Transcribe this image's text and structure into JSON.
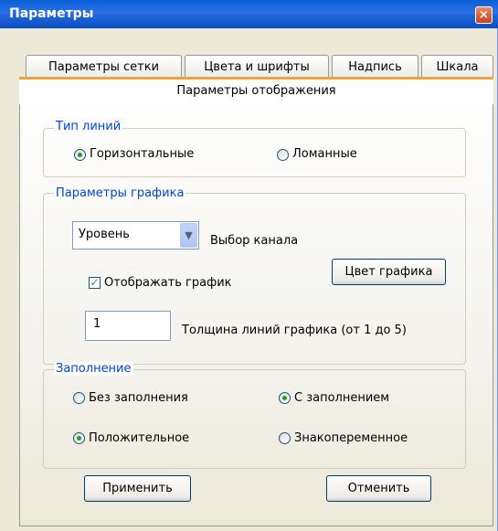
{
  "window": {
    "title": "Параметры",
    "close_icon": "×"
  },
  "tabs": [
    "Параметры сетки",
    "Цвета и шрифты",
    "Надпись",
    "Шкала"
  ],
  "active_tab": "Параметры отображения",
  "line_type": {
    "legend": "Тип линий",
    "options": [
      {
        "label": "Горизонтальные",
        "selected": true
      },
      {
        "label": "Ломанные",
        "selected": false
      }
    ]
  },
  "graph_params": {
    "legend": "Параметры графика",
    "channel_select": {
      "value": "Уровень",
      "label": "Выбор канала"
    },
    "show_graph": {
      "label": "Отображать график",
      "checked": true
    },
    "color_button": "Цвет графика",
    "thickness": {
      "value": "1",
      "label": "Толщина линий графика (от 1 до 5)"
    }
  },
  "fill": {
    "legend": "Заполнение",
    "options": [
      {
        "label": "Без заполнения",
        "selected": false
      },
      {
        "label": "С заполнением",
        "selected": true
      },
      {
        "label": "Положительное",
        "selected": true
      },
      {
        "label": "Знакопеременное",
        "selected": false
      }
    ]
  },
  "buttons": {
    "apply": "Применить",
    "cancel": "Отменить"
  }
}
